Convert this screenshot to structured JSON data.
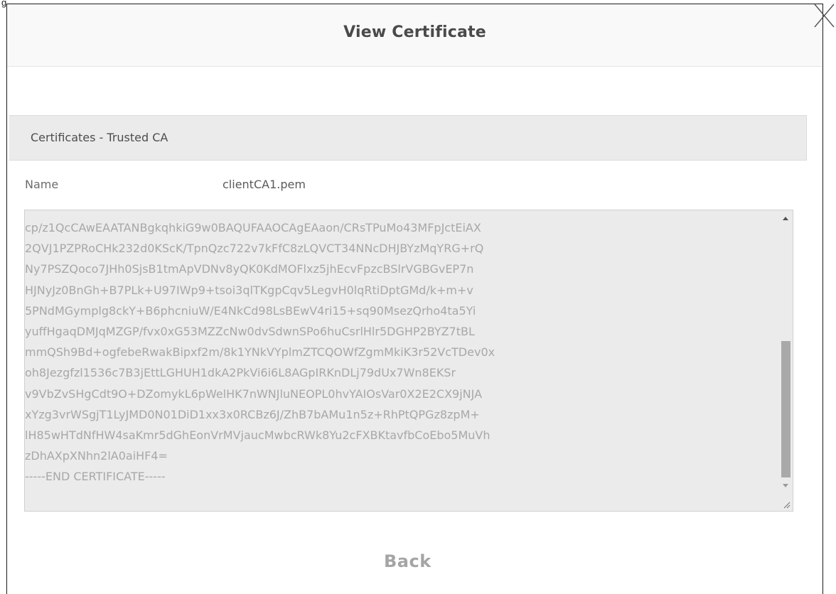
{
  "figure_label": "g",
  "dialog": {
    "title": "View Certificate",
    "close_icon": "close-icon"
  },
  "section": {
    "title": "Certificates - Trusted CA"
  },
  "name_field": {
    "label": "Name",
    "value": "clientCA1.pem"
  },
  "certificate": {
    "lines": [
      "cp/z1QcCAwEAATANBgkqhkiG9w0BAQUFAAOCAgEAaon/CRsTPuMo43MFpJctEiAX",
      "2QVJ1PZPRoCHk232d0KScK/TpnQzc722v7kFfC8zLQVCT34NNcDHJBYzMqYRG+rQ",
      "Ny7PSZQoco7JHh0SjsB1tmApVDNv8yQK0KdMOFlxz5jhEcvFpzcBSlrVGBGvEP7n",
      "HJNyJz0BnGh+B7PLk+U97IWp9+tsoi3qlTKgpCqv5LegvH0lqRtiDptGMd/k+m+v",
      "5PNdMGymplg8ckY+B6phcniuW/E4NkCd98LsBEwV4ri15+sq90MsezQrho4ta5Yi",
      "yuffHgaqDMJqMZGP/fvx0xG53MZZcNw0dvSdwnSPo6huCsrlHlr5DGHP2BYZ7tBL",
      "mmQSh9Bd+ogfebeRwakBipxf2m/8k1YNkVYplmZTCQOWfZgmMkiK3r52VcTDev0x",
      "oh8Jezgfzl1536c7B3jEttLGHUH1dkA2PkVi6i6L8AGpIRKnDLj79dUx7Wn8EKSr",
      "v9VbZvSHgCdt9O+DZomykL6pWelHK7nWNJluNEOPL0hvYAIOsVar0X2E2CX9jNJA",
      "xYzg3vrWSgjT1LyJMD0N01DiD1xx3x0RCBz6J/ZhB7bAMu1n5z+RhPtQPGz8zpM+",
      "lH85wHTdNfHW4saKmr5dGhEonVrMVjaucMwbcRWk8Yu2cFXBKtavfbCoEbo5MuVh",
      "zDhAXpXNhn2lA0aiHF4=",
      "-----END CERTIFICATE-----"
    ]
  },
  "footer": {
    "back_label": "Back"
  }
}
